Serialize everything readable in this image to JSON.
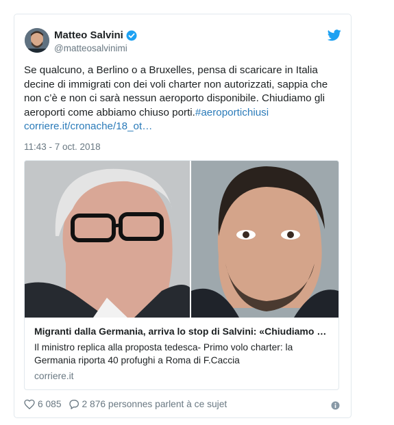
{
  "author": {
    "name": "Matteo Salvini",
    "handle": "@matteosalvinimi"
  },
  "tweet": {
    "text_plain": "Se qualcuno, a Berlino o a Bruxelles, pensa di scaricare in Italia decine di immigrati con dei voli charter non autorizzati, sappia che non c’è e non ci sarà nessun aeroporto disponibile. Chiudiamo gli aeroporti come abbiamo chiuso porti.",
    "hashtag": "#aeroportichiusi",
    "link": "corriere.it/cronache/18_ot…",
    "timestamp": "11:43 - 7 oct. 2018"
  },
  "media_card": {
    "title": "Migranti dalla Germania, arriva lo stop di Salvini: «Chiudiamo …",
    "description": "Il ministro replica alla proposta tedesca- Primo volo charter: la Germania riporta 40 profughi a Roma di F.Caccia",
    "domain": "corriere.it"
  },
  "actions": {
    "likes": "6 085",
    "comments": "2 876 personnes parlent à ce sujet"
  },
  "colors": {
    "link": "#2b7bb9",
    "verified": "#1da1f2",
    "muted": "#697882",
    "border": "#e1e8ed"
  },
  "icons": [
    "verified-badge-icon",
    "twitter-bird-icon",
    "heart-icon",
    "comment-icon",
    "info-icon"
  ]
}
